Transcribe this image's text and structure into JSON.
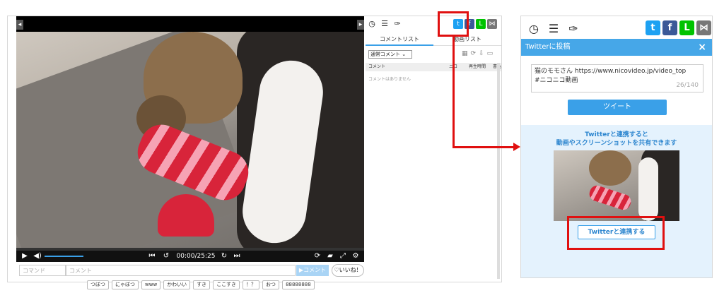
{
  "player": {
    "time_display": "00:00/25:25",
    "progress_fraction": 0.0
  },
  "comment_bar": {
    "command_placeholder": "コマンド",
    "comment_placeholder": "コメント",
    "comment_button": "▶コメント",
    "like_button": "♡いいね！"
  },
  "quick_comments": [
    "つぼつ",
    "にゃぼつ",
    "www",
    "かわいい",
    "すき",
    "ここすき",
    "！？",
    "おつ",
    "88888888"
  ],
  "side_panel": {
    "tabs": [
      "コメントリスト",
      "動画リスト"
    ],
    "select_value": "通常コメント",
    "columns": [
      "コメント",
      "ニコ",
      "再生時間",
      "書込"
    ],
    "empty_message": "コメントはありません"
  },
  "share_popup": {
    "header_title": "Twitterに投稿",
    "close_label": "×",
    "tweet_text_line1": "猫のモモさん https://www.nicovideo.jp/video_top",
    "tweet_text_line2": "#ニコニコ動画",
    "char_count": "26/140",
    "tweet_button": "ツイート",
    "link_text_line1": "Twitterと連携すると",
    "link_text_line2": "動画やスクリーンショットを共有できます",
    "link_button": "Twitterと連携する"
  },
  "colors": {
    "twitter": "#1da1f2",
    "facebook": "#3b5998",
    "line": "#00c300",
    "share": "#777777",
    "highlight": "#e01010",
    "accent": "#3aa0e8"
  }
}
